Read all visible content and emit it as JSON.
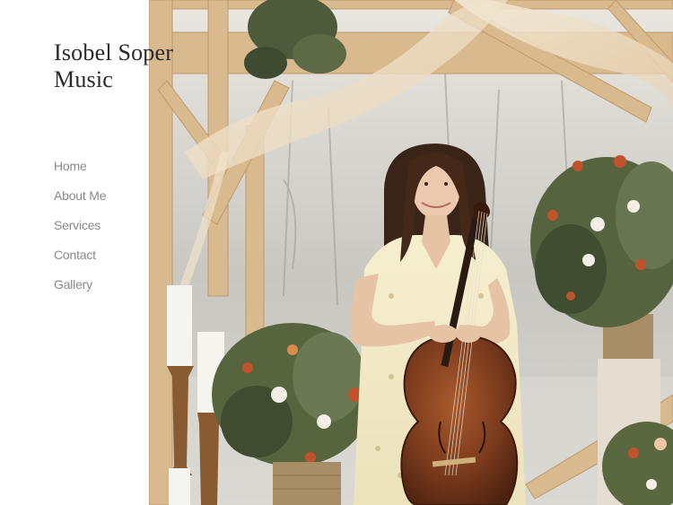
{
  "site": {
    "title": "Isobel Soper\nMusic"
  },
  "nav": {
    "items": [
      {
        "label": "Home"
      },
      {
        "label": "About Me"
      },
      {
        "label": "Services"
      },
      {
        "label": "Contact"
      },
      {
        "label": "Gallery"
      }
    ]
  },
  "hero": {
    "image": "photo of a woman in a floral dress holding a cello under a draped wooden pergola with flower arrangements and candles"
  },
  "colors": {
    "title": "#2a2a2a",
    "nav": "#8a8a8a",
    "background": "#ffffff",
    "wood": "#d9b98e",
    "cello": "#7a3a1c"
  }
}
